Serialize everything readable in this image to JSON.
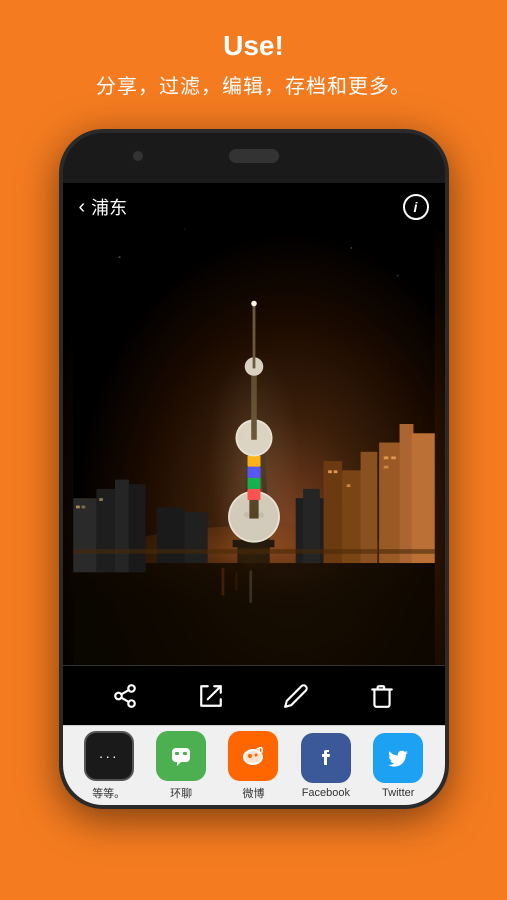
{
  "header": {
    "title": "Use!",
    "subtitle": "分享，过滤，编辑，存档和更多。"
  },
  "phone": {
    "screen_title": "浦东",
    "info_label": "i"
  },
  "toolbar": {
    "icons": [
      "share",
      "import",
      "edit",
      "delete"
    ]
  },
  "apps": [
    {
      "id": "more",
      "label": "等等。",
      "symbol": "···"
    },
    {
      "id": "hangout",
      "label": "环聊",
      "symbol": "❝"
    },
    {
      "id": "weibo",
      "label": "微博",
      "symbol": "微"
    },
    {
      "id": "facebook",
      "label": "Facebook",
      "symbol": "f"
    },
    {
      "id": "twitter",
      "label": "Twitter",
      "symbol": "🐦"
    }
  ]
}
